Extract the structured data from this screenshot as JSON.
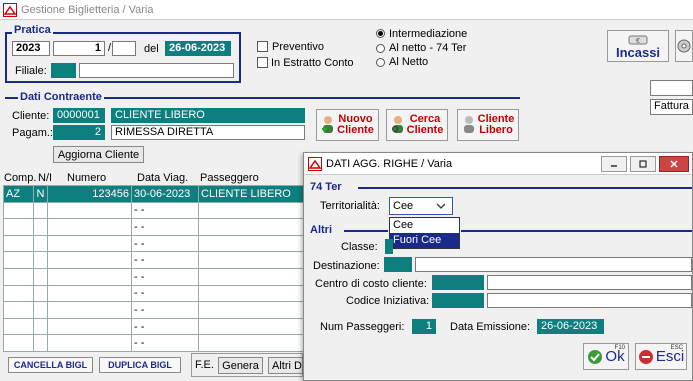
{
  "window": {
    "title": "Gestione Biglietteria / Varia"
  },
  "pratica": {
    "label": "Pratica",
    "year": "2023",
    "number": "1",
    "separator": "/",
    "suffix": "",
    "del_label": "del",
    "date": "26-06-2023",
    "filiale_label": "Filiale:",
    "filiale_code": "",
    "filiale_name": ""
  },
  "flags": {
    "preventivo": "Preventivo",
    "estratto_conto": "In Estratto Conto"
  },
  "mode": {
    "options": [
      "Intermediazione",
      "Al netto - 74 Ter",
      "Al Netto"
    ],
    "selected": 0
  },
  "incassi": {
    "label": "Incassi"
  },
  "fattura": {
    "label": "Fattura r"
  },
  "contraente": {
    "label": "Dati Contraente",
    "cliente_label": "Cliente:",
    "cliente_code": "0000001",
    "cliente_name": "CLIENTE LIBERO",
    "pagam_label": "Pagam.:",
    "pagam_code": "2",
    "pagam_name": "RIMESSA DIRETTA",
    "aggiorna": "Aggiorna Cliente"
  },
  "client_buttons": {
    "nuovo": [
      "Nuovo",
      "Cliente"
    ],
    "cerca": [
      "Cerca",
      "Cliente"
    ],
    "libero": [
      "Cliente",
      "Libero"
    ]
  },
  "grid": {
    "headers": [
      "Comp.",
      "N/I",
      "Numero",
      "Data Viag.",
      "Passeggero"
    ],
    "rows": [
      [
        "AZ",
        "N",
        "123456",
        "30-06-2023",
        "CLIENTE LIBERO"
      ],
      [
        "",
        "",
        "",
        "- -",
        ""
      ],
      [
        "",
        "",
        "",
        "- -",
        ""
      ],
      [
        "",
        "",
        "",
        "- -",
        ""
      ],
      [
        "",
        "",
        "",
        "- -",
        ""
      ],
      [
        "",
        "",
        "",
        "- -",
        ""
      ],
      [
        "",
        "",
        "",
        "- -",
        ""
      ],
      [
        "",
        "",
        "",
        "- -",
        ""
      ],
      [
        "",
        "",
        "",
        "- -",
        ""
      ],
      [
        "",
        "",
        "",
        "- -",
        ""
      ]
    ]
  },
  "bottom": {
    "cancella": "CANCELLA BIGL",
    "duplica": "DUPLICA BIGL",
    "fe_label": "F.E.",
    "genera": "Genera",
    "altri": "Altri D"
  },
  "dialog": {
    "title": "DATI AGG. RIGHE / Varia",
    "sect74": "74 Ter",
    "territorialita_label": "Territorialità:",
    "territorialita_value": "Cee",
    "territorialita_options": [
      "Cee",
      "Fuori Cee"
    ],
    "highlighted_option": 1,
    "sectAltri": "Altri",
    "classe_label": "Classe:",
    "destinazione_label": "Destinazione:",
    "centro_label": "Centro di costo cliente:",
    "codice_label": "Codice Iniziativa:",
    "num_pass_label": "Num Passeggeri:",
    "num_pass_value": "1",
    "data_em_label": "Data Emissione:",
    "data_em_value": "26-06-2023",
    "ok_label": "Ok",
    "ok_key": "F10",
    "esci_label": "Esci",
    "esci_key": "ESC"
  },
  "colors": {
    "accent": "#0e7f7f",
    "section": "#1a2a8a",
    "button_text": "#c00000"
  }
}
